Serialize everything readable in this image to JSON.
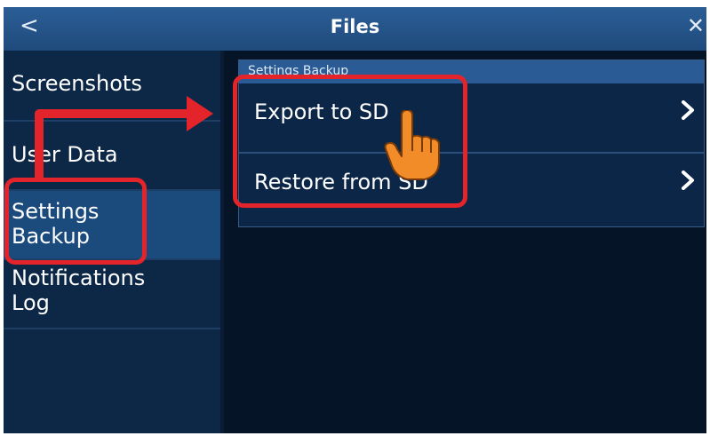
{
  "window": {
    "title": "Files",
    "back_glyph": "<",
    "close_glyph": "✕"
  },
  "sidebar": {
    "items": [
      {
        "label": "Screenshots"
      },
      {
        "label": "User Data"
      },
      {
        "label": "Settings Backup",
        "active": true
      },
      {
        "label": "Notifications Log"
      }
    ]
  },
  "panel": {
    "header": "Settings Backup",
    "rows": [
      {
        "label": "Export to SD",
        "icon": "chevron-right-icon"
      },
      {
        "label": "Restore from SD",
        "icon": "chevron-right-icon"
      }
    ]
  },
  "annotations": {
    "color": "#e3242b",
    "pointer": "hand-pointer-icon"
  },
  "colors": {
    "titlebar": "#2b5e96",
    "sidebar": "#0d2747",
    "sidebar_active": "#1b4a7d",
    "panel": "#0c2647",
    "panel_header": "#2b5b94",
    "hand": "#f28c28"
  }
}
